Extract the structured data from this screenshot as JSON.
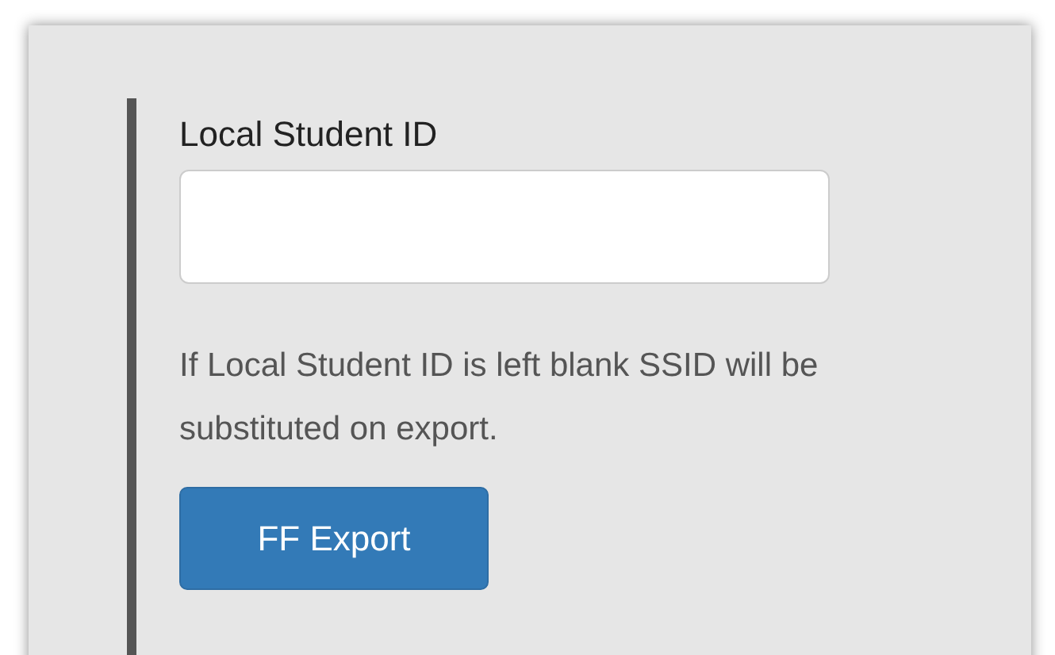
{
  "field": {
    "label": "Local Student ID"
  },
  "help_text": "If Local Student ID is left blank SSID will be substituted on export.",
  "button": {
    "label": "FF Export"
  }
}
